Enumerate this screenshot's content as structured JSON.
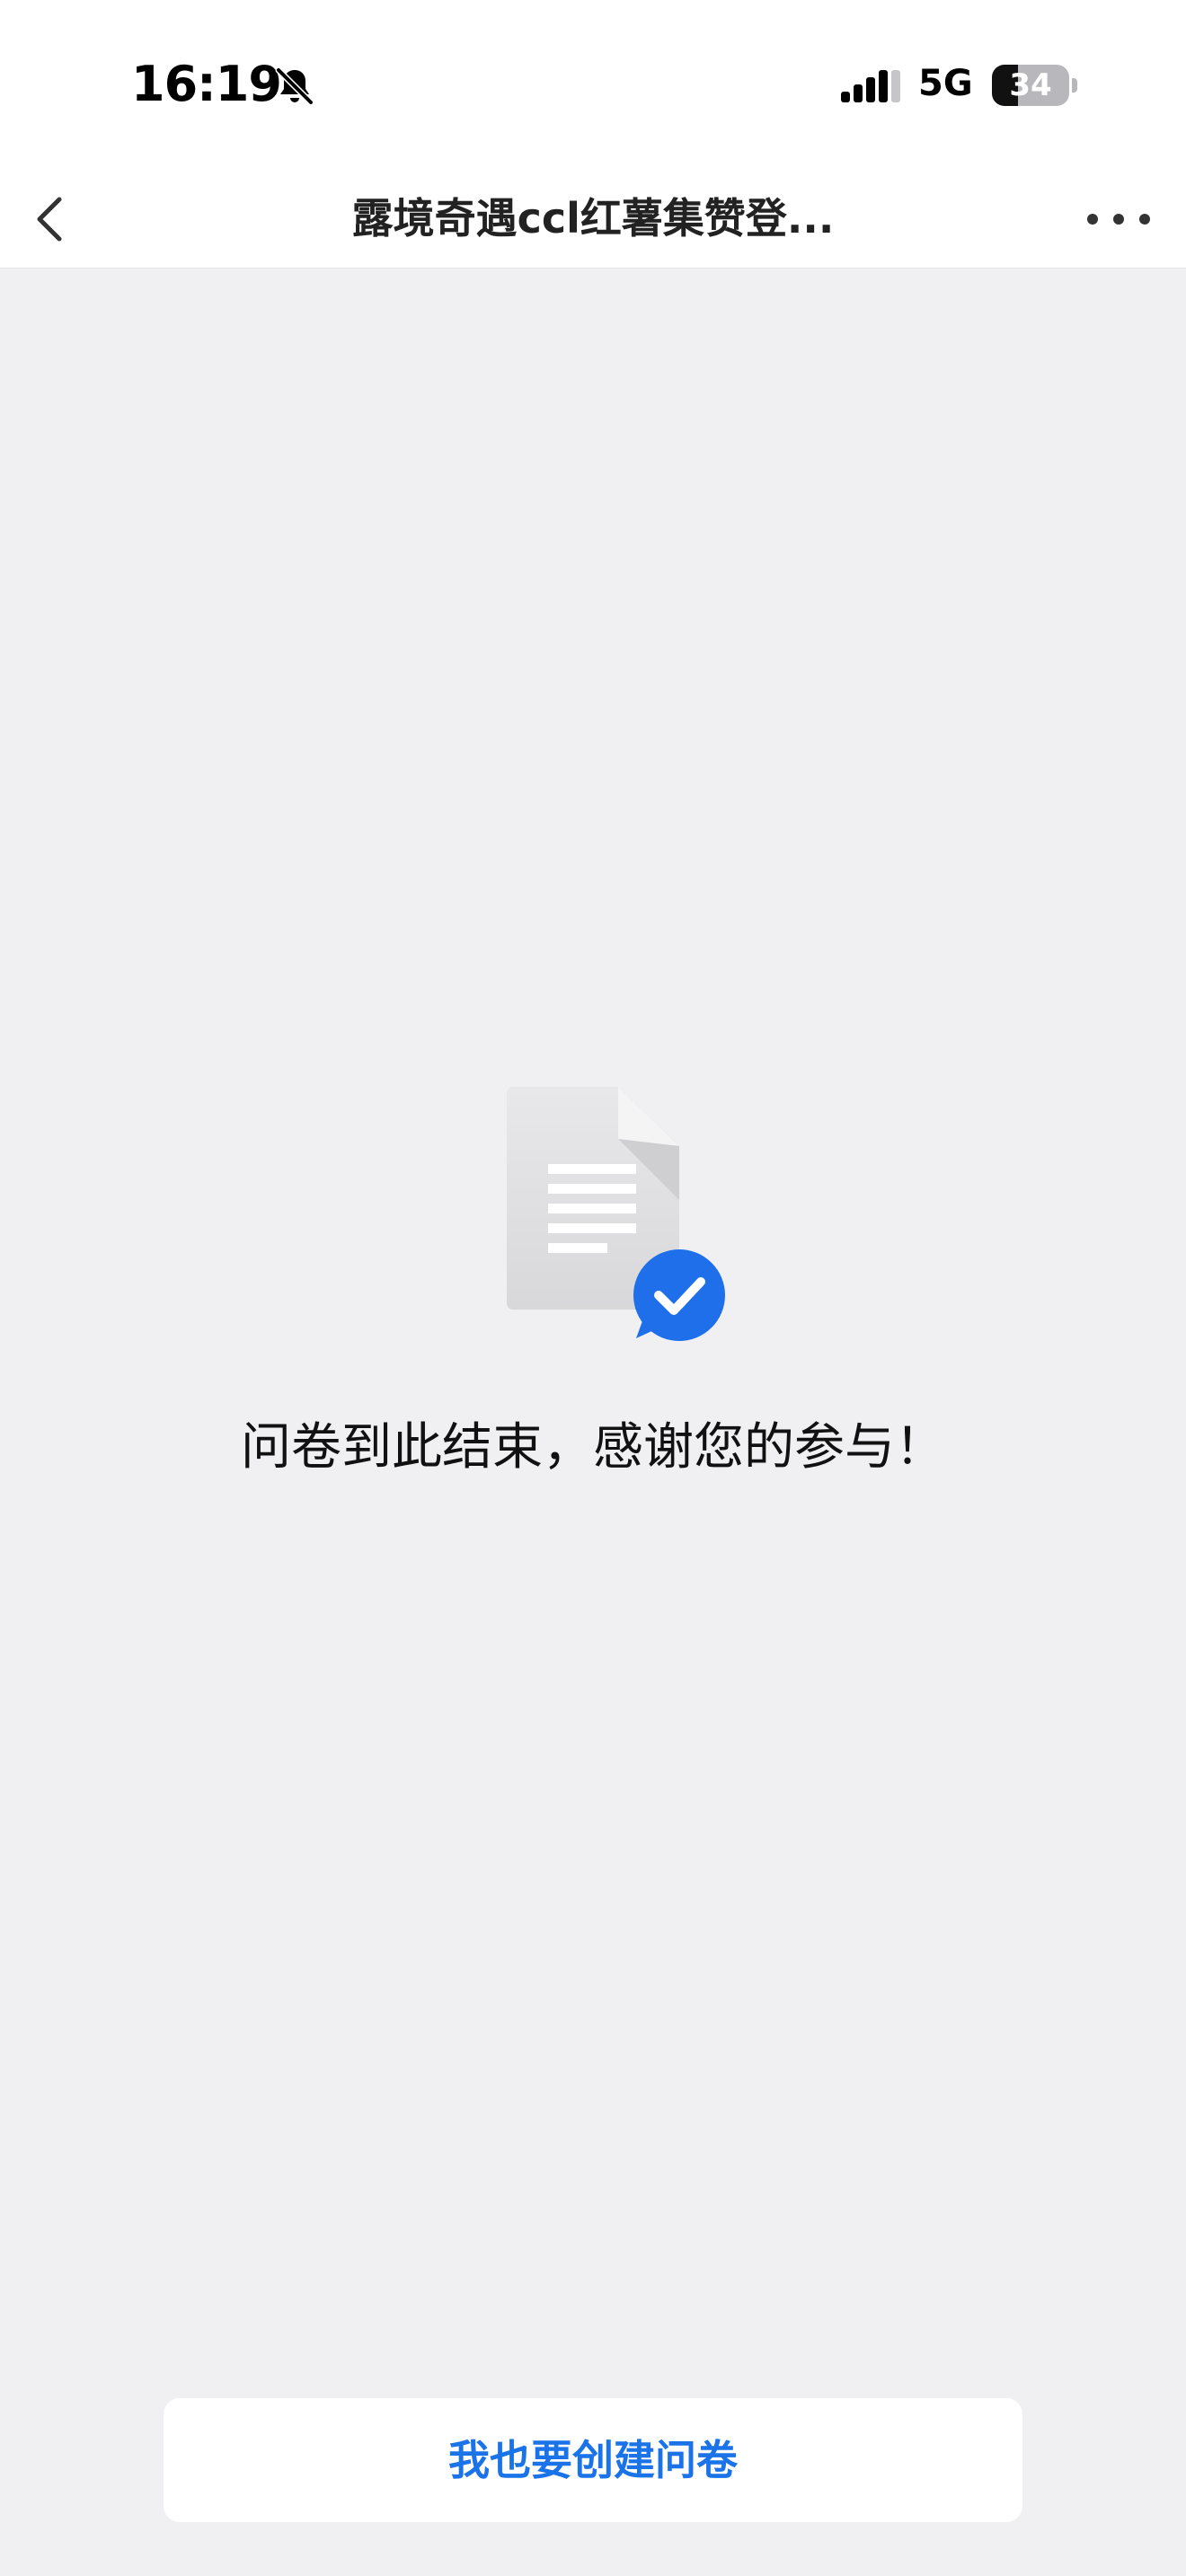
{
  "status_bar": {
    "time": "16:19",
    "network": "5G",
    "battery_level": "34",
    "battery_fraction": 0.34
  },
  "nav": {
    "title": "露境奇遇ccl红薯集赞登...",
    "back_icon": "chevron-left-icon",
    "more_icon": "more-horizontal-icon"
  },
  "content": {
    "illustration_icon": "document-check-icon",
    "message": "问卷到此结束，感谢您的参与！"
  },
  "footer": {
    "create_button_label": "我也要创建问卷"
  },
  "colors": {
    "background": "#f0f0f2",
    "accent": "#1a73e8",
    "check_badge": "#1f6feb"
  }
}
